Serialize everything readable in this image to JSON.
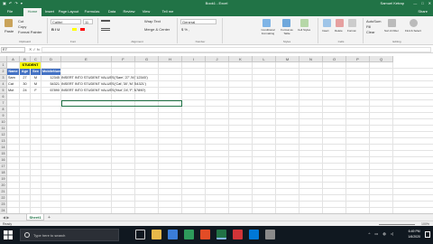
{
  "titlebar": {
    "qat": "▣ ↶ ↷ ▾",
    "title": "Book1 - Excel",
    "user": "Samuel Ketrap",
    "controls": [
      "—",
      "□",
      "✕"
    ]
  },
  "ribbon_tabs": [
    "File",
    "Home",
    "Insert",
    "Page Layout",
    "Formulas",
    "Data",
    "Review",
    "View",
    "Tell me"
  ],
  "share_label": "Share",
  "ribbon": {
    "paste": "Paste",
    "cut": "Cut",
    "copy": "Copy",
    "format_painter": "Format Painter",
    "font_name": "Calibri",
    "font_size": "11",
    "font_style": "B I U",
    "wrap_text": "Wrap Text",
    "merge_center": "Merge & Center",
    "number_format": "General",
    "number_symbols": "$ % ,",
    "conditional_formatting": "Conditional Formatting",
    "format_as_table": "Format as Table",
    "cell_styles": "Cell Styles",
    "insert": "Insert",
    "delete": "Delete",
    "format": "Format",
    "autosum": "AutoSum",
    "fill": "Fill",
    "clear": "Clear",
    "sort_filter": "Sort & Filter",
    "find_select": "Find & Select",
    "groups": [
      "Clipboard",
      "Font",
      "Alignment",
      "Number",
      "Styles",
      "Cells",
      "Editing"
    ]
  },
  "formula_bar": {
    "name_box": "E7",
    "fx_icons": "✕ ✓ fx",
    "value": ""
  },
  "columns": [
    "A",
    "B",
    "C",
    "D",
    "E",
    "F",
    "G",
    "H",
    "I",
    "J",
    "K",
    "L",
    "M",
    "N",
    "O",
    "P",
    "Q"
  ],
  "rows": [
    "1",
    "2",
    "3",
    "4",
    "5",
    "6",
    "7",
    "8",
    "9",
    "10",
    "11",
    "12",
    "13",
    "14",
    "15",
    "16",
    "17",
    "18",
    "19",
    "20",
    "21",
    "22",
    "23",
    "24"
  ],
  "sheet": {
    "student_header": "STUDENT",
    "headers": [
      "Name",
      "Age",
      "Sex",
      "MobileNumber"
    ],
    "data": [
      [
        "Sam",
        "27",
        "M",
        "12345",
        "INSERT INTO STUDENT VALUES('Sam','27','M','12345')"
      ],
      [
        "Cat",
        "30",
        "M",
        "54321",
        "INSERT INTO STUDENT VALUES('Cat','30','M','54321')"
      ],
      [
        "Mut",
        "24",
        "F",
        "67890",
        "INSERT INTO STUDENT VALUES('Mut','24','F','67890')"
      ]
    ]
  },
  "sheet_tabs": [
    "Sheet1"
  ],
  "add_sheet": "+",
  "sheet_nav": "◀ ▶",
  "status": {
    "ready": "Ready",
    "zoom": "100%"
  },
  "taskbar": {
    "search_placeholder": "Type here to search",
    "tray_icons": "^ ▭ ◍ ◁",
    "time": "6:49 PM",
    "date": "1/6/2020"
  },
  "colors": {
    "excel_green": "#217346",
    "header_blue": "#4472c4",
    "student_yellow": "#ffff00",
    "taskbar": "#101820"
  }
}
